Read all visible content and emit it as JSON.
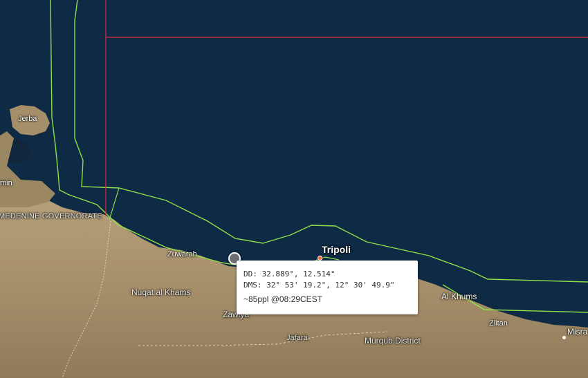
{
  "map": {
    "colors": {
      "sea": "#0f2a44",
      "land": "#a8936f",
      "eez_boundary": "#8ee04a",
      "grid_line": "#e0263a"
    },
    "places": {
      "jerba": "Jerba",
      "min": "min",
      "medenine": "MEDENINE GOVERNORATE",
      "zuwarah": "Zuwarah",
      "nuqat": "Nuqat al Khams",
      "tripoli": "Tripoli",
      "zawiya": "Zawiya",
      "jafara": "Jafara",
      "murqub": "Murqub District",
      "al_khums": "Al Khums",
      "zlitan": "Zlitan",
      "misrata": "Misra"
    }
  },
  "popup": {
    "dd": "DD: 32.889°, 12.514°",
    "dms": "DMS: 32° 53' 19.2\", 12° 30' 49.9\"",
    "info": "~85ppl @08:29CEST"
  }
}
